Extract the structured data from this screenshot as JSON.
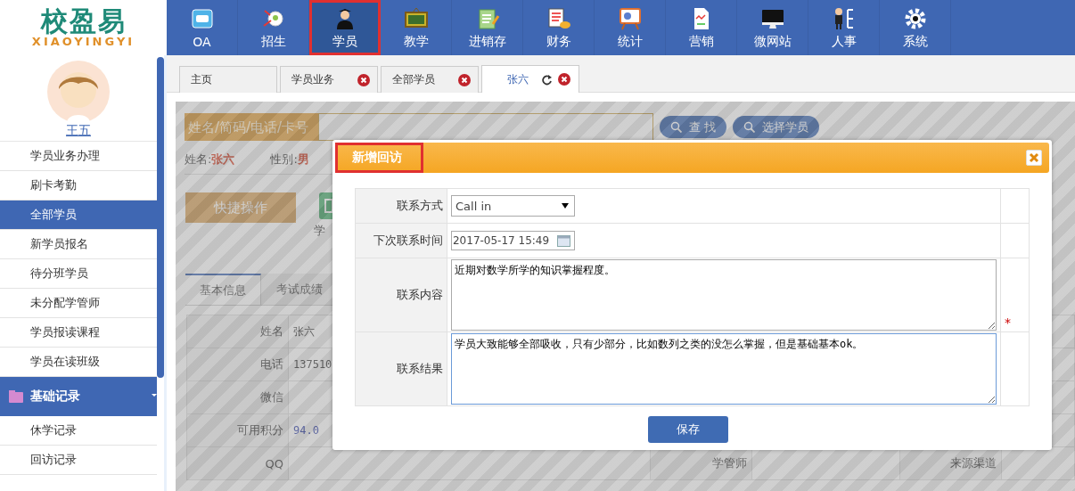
{
  "logo": {
    "name": "校盈易",
    "subtitle": "XIAOYINGYI"
  },
  "nav": [
    {
      "label": "OA",
      "kind": "oa",
      "selected": false,
      "highlighted": false
    },
    {
      "label": "招生",
      "kind": "enroll",
      "selected": false,
      "highlighted": false
    },
    {
      "label": "学员",
      "kind": "student",
      "selected": true,
      "highlighted": true
    },
    {
      "label": "教学",
      "kind": "board",
      "selected": false,
      "highlighted": false
    },
    {
      "label": "进销存",
      "kind": "clipboard",
      "selected": false,
      "highlighted": false
    },
    {
      "label": "财务",
      "kind": "coins",
      "selected": false,
      "highlighted": false
    },
    {
      "label": "统计",
      "kind": "easel",
      "selected": false,
      "highlighted": false
    },
    {
      "label": "营销",
      "kind": "document",
      "selected": false,
      "highlighted": false
    },
    {
      "label": "微网站",
      "kind": "monitor",
      "selected": false,
      "highlighted": false
    },
    {
      "label": "人事",
      "kind": "person",
      "selected": false,
      "highlighted": false
    },
    {
      "label": "系统",
      "kind": "gear",
      "selected": false,
      "highlighted": false
    }
  ],
  "user": {
    "name": "王五"
  },
  "sidebar": {
    "items": [
      {
        "label": "学员业务办理",
        "selected": false
      },
      {
        "label": "刷卡考勤",
        "selected": false
      },
      {
        "label": "全部学员",
        "selected": true
      },
      {
        "label": "新学员报名",
        "selected": false
      },
      {
        "label": "待分班学员",
        "selected": false
      },
      {
        "label": "未分配学管师",
        "selected": false
      },
      {
        "label": "学员报读课程",
        "selected": false
      },
      {
        "label": "学员在读班级",
        "selected": false
      }
    ],
    "section": {
      "label": "基础记录",
      "expanded": true
    },
    "section_items": [
      {
        "label": "休学记录",
        "selected": false
      },
      {
        "label": "回访记录",
        "selected": false
      }
    ]
  },
  "page_tabs": [
    {
      "label": "主页",
      "selected": false,
      "closable": false,
      "refresh": false
    },
    {
      "label": "学员业务",
      "selected": false,
      "closable": true,
      "refresh": false
    },
    {
      "label": "全部学员",
      "selected": false,
      "closable": true,
      "refresh": false
    },
    {
      "label": "张六",
      "selected": true,
      "closable": true,
      "refresh": true
    }
  ],
  "search": {
    "placeholder": "姓名/简码/电话/卡号",
    "buttons": [
      "查 找",
      "选择学员"
    ]
  },
  "student_summary": [
    {
      "label": "姓名:",
      "value": "张六"
    },
    {
      "label": "性别:",
      "value": "男"
    }
  ],
  "quick_action": "快捷操作",
  "action_label": "学",
  "detail_tabs": [
    {
      "label": "基本信息",
      "selected": true
    },
    {
      "label": "考试成绩",
      "selected": false
    }
  ],
  "detail_rows": [
    {
      "label": "姓名",
      "value": "张六"
    },
    {
      "label": "电话",
      "value": "137510"
    },
    {
      "label": "微信"
    },
    {
      "label": "可用积分",
      "value": "94.0"
    },
    {
      "label": "QQ",
      "label_2": "学管师",
      "label_3": "来源渠道"
    }
  ],
  "dialog": {
    "title": "新增回访",
    "highlighted": true,
    "fields": [
      {
        "kind": "select",
        "label": "联系方式",
        "value": "Call in",
        "required": false,
        "focused": false
      },
      {
        "kind": "datetime",
        "label": "下次联系时间",
        "value": "2017-05-17 15:49",
        "required": false,
        "focused": false
      },
      {
        "kind": "textarea",
        "label": "联系内容",
        "value": "近期对数学所学的知识掌握程度。",
        "required": true,
        "focused": false
      },
      {
        "kind": "textarea",
        "label": "联系结果",
        "value": "学员大致能够全部吸收，只有少部分，比如数列之类的没怎么掌握，但是基础基本ok。",
        "required": false,
        "focused": true
      }
    ],
    "required_mark": "*",
    "save": "保存"
  }
}
